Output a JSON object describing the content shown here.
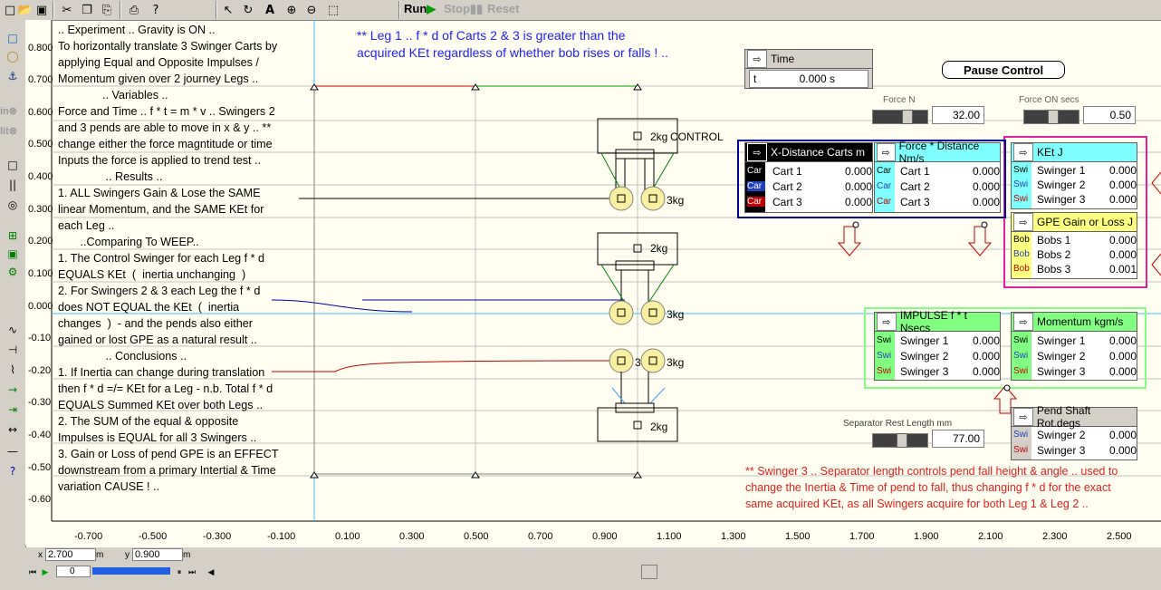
{
  "toolbar": {
    "run_label": "Run",
    "stop_label": "Stop",
    "reset_label": "Reset"
  },
  "left_text": ".. Experiment .. Gravity is ON ..\nTo horizontally translate 3 Swinger Carts by\napplying Equal and Opposite Impulses /\nMomentum given over 2 journey Legs ..\n              .. Variables ..\nForce and Time .. f * t = m * v .. Swingers 2\nand 3 pends are able to move in x & y .. **\nchange either the force magntitude or time\nInputs the force is applied to trend test ..\n               .. Results ..\n1. ALL Swingers Gain & Lose the SAME\nlinear Momentum, and the SAME KEt for\neach Leg ..\n       ..Comparing To WEEP..\n1. The Control Swinger for each Leg f * d\nEQUALS KEt  (  inertia unchanging  )\n2. For Swingers 2 & 3 each Leg the f * d\ndoes NOT EQUAL the KEt  (  inertia\nchanges  )  - and the pends also either\ngained or lost GPE as a natural result ..\n               .. Conclusions ..\n1. If Inertia can change during translation\nthen f * d =/= KEt for a Leg - n.b. Total f * d\nEQUALS Summed KEt over both Legs ..\n2. The SUM of the equal & opposite\nImpulses is EQUAL for all 3 Swingers ..\n3. Gain or Loss of pend GPE is an EFFECT\ndownstream from a primary Intertial & Time\nvariation CAUSE ! ..",
  "top_note": "** Leg 1 .. f * d of Carts 2 & 3 is greater than the\nacquired KEt regardless of whether bob rises or falls ! ..",
  "bottom_note": "** Swinger 3 .. Separator length controls pend fall height & angle .. used to\nchange the Inertia & Time of pend to fall, thus changing f * d for the exact\nsame acquired KEt, as all Swingers acquire for both Leg 1 & Leg 2 ..",
  "time_panel": {
    "title": "Time",
    "var": "t",
    "value": "0.000 s"
  },
  "pause_label": "Pause Control",
  "force": {
    "label": "Force N",
    "value": "32.00"
  },
  "force_secs": {
    "label": "Force ON secs",
    "value": "0.50"
  },
  "separator": {
    "label": "Separator Rest Length mm",
    "value": "77.00"
  },
  "panels": {
    "xdist": {
      "title": "X-Distance Carts m",
      "rows": [
        {
          "label": "Cart 1",
          "value": "0.000"
        },
        {
          "label": "Cart 2",
          "value": "0.000"
        },
        {
          "label": "Cart 3",
          "value": "0.000"
        }
      ],
      "tag": "Car"
    },
    "fd": {
      "title": "Force * Distance Nm/s",
      "rows": [
        {
          "label": "Cart 1",
          "value": "0.000"
        },
        {
          "label": "Cart 2",
          "value": "0.000"
        },
        {
          "label": "Cart 3",
          "value": "0.000"
        }
      ],
      "tag": "Car"
    },
    "ket": {
      "title": "KEt  J",
      "rows": [
        {
          "label": "Swinger 1",
          "value": "0.000"
        },
        {
          "label": "Swinger 2",
          "value": "0.000"
        },
        {
          "label": "Swinger 3",
          "value": "0.000"
        }
      ],
      "tag": "Swi"
    },
    "gpe": {
      "title": "GPE Gain or Loss J",
      "rows": [
        {
          "label": "Bobs 1",
          "value": "0.000"
        },
        {
          "label": "Bobs 2",
          "value": "0.000"
        },
        {
          "label": "Bobs 3",
          "value": "0.001"
        }
      ],
      "tag": "Bob"
    },
    "impulse": {
      "title": "IMPULSE f * t  Nsecs",
      "rows": [
        {
          "label": "Swinger 1",
          "value": "0.000"
        },
        {
          "label": "Swinger 2",
          "value": "0.000"
        },
        {
          "label": "Swinger 3",
          "value": "0.000"
        }
      ],
      "tag": "Swi"
    },
    "momentum": {
      "title": "Momentum kgm/s",
      "rows": [
        {
          "label": "Swinger 1",
          "value": "0.000"
        },
        {
          "label": "Swinger 2",
          "value": "0.000"
        },
        {
          "label": "Swinger 3",
          "value": "0.000"
        }
      ],
      "tag": "Swi"
    },
    "pend": {
      "title": "Pend Shaft Rot.degs",
      "rows": [
        {
          "label": "Swinger 2",
          "value": "0.000"
        },
        {
          "label": "Swinger 3",
          "value": "0.000"
        }
      ],
      "tag": "Swi"
    }
  },
  "diagram_labels": {
    "control": "CONTROL",
    "kg2": "2kg",
    "kg3": "3kg",
    "num3": "3"
  },
  "y_ticks": [
    "0.800",
    "0.700",
    "0.600",
    "0.500",
    "0.400",
    "0.300",
    "0.200",
    "0.100",
    "0.000",
    "-0.10",
    "-0.20",
    "-0.30",
    "-0.40",
    "-0.50",
    "-0.60"
  ],
  "x_ticks": [
    "-0.700",
    "-0.500",
    "-0.300",
    "-0.100",
    "0.100",
    "0.300",
    "0.500",
    "0.700",
    "0.900",
    "1.100",
    "1.300",
    "1.500",
    "1.700",
    "1.900",
    "2.100",
    "2.300",
    "2.500"
  ],
  "coords": {
    "x_label": "x",
    "x_value": "2.700",
    "x_unit": "m",
    "y_label": "y",
    "y_value": "0.900",
    "y_unit": "m"
  },
  "frame_value": "0",
  "left_tools": [
    "in⊗",
    "lit⊗"
  ]
}
